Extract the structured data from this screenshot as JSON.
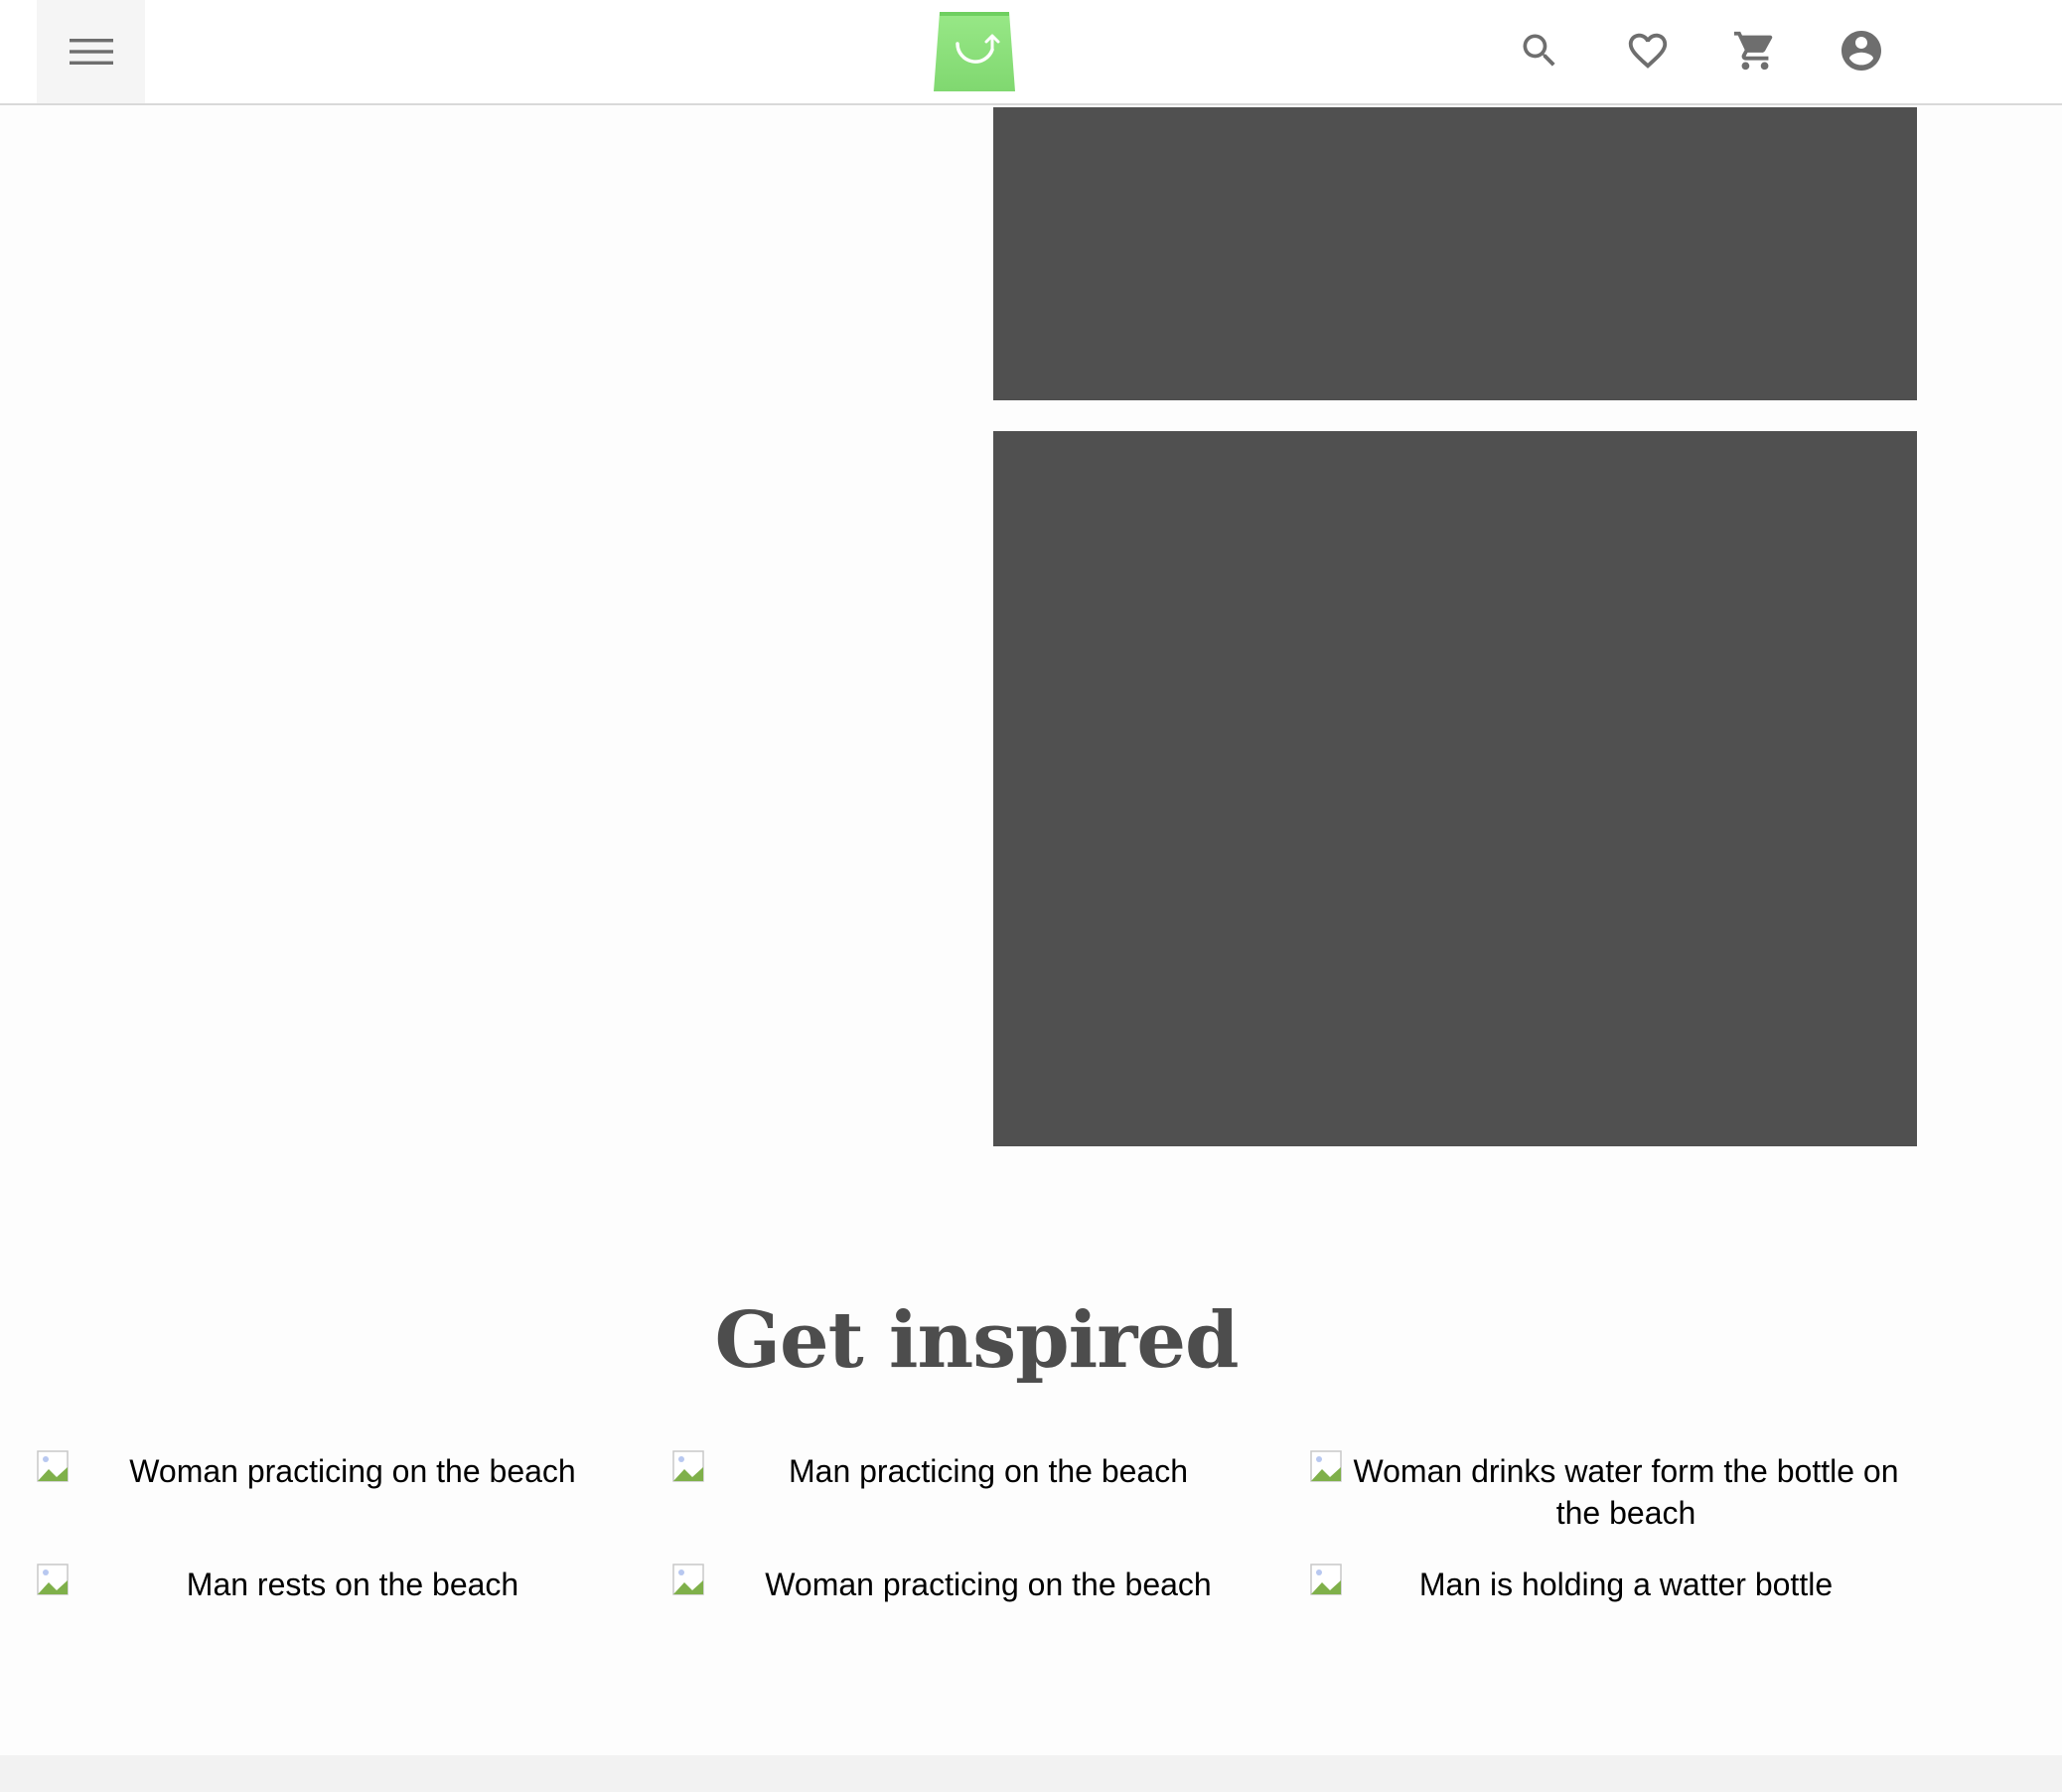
{
  "header": {
    "menu_icon": "hamburger-menu-icon",
    "logo_icon": "shopping-bag-logo-icon",
    "actions": [
      {
        "name": "search",
        "icon": "search-icon"
      },
      {
        "name": "wishlist",
        "icon": "heart-icon"
      },
      {
        "name": "cart",
        "icon": "cart-icon"
      },
      {
        "name": "account",
        "icon": "account-circle-icon"
      }
    ]
  },
  "colors": {
    "panel": "#505050",
    "logo_green": "#8ee07a",
    "icon_gray": "#6e6e6e",
    "title_gray": "#4d4d4d"
  },
  "inspire": {
    "title": "Get inspired",
    "items": [
      {
        "caption": "Woman practicing on the beach"
      },
      {
        "caption": "Man practicing on the beach"
      },
      {
        "caption": "Woman drinks water form the bottle on the beach"
      },
      {
        "caption": "Man rests on the beach"
      },
      {
        "caption": "Woman practicing on the beach"
      },
      {
        "caption": "Man is holding a watter bottle"
      }
    ]
  }
}
